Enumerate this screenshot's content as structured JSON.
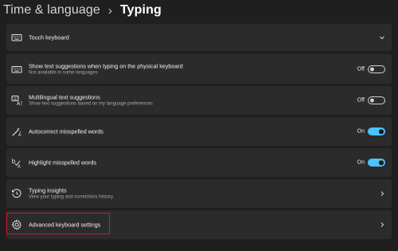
{
  "header": {
    "breadcrumb_parent": "Time & language",
    "separator": "›",
    "page_title": "Typing"
  },
  "settings": {
    "touch_keyboard": {
      "label": "Touch keyboard",
      "icon": "keyboard-icon",
      "expanded": false
    },
    "text_suggestions": {
      "label": "Show text suggestions when typing on the physical keyboard",
      "sublabel": "Not available in some languages",
      "state": "Off",
      "enabled": false,
      "icon": "keyboard-suggestions-icon"
    },
    "multilingual": {
      "label": "Multilingual text suggestions",
      "sublabel": "Show text suggestions based on my language preferences",
      "state": "Off",
      "enabled": false,
      "icon": "multilingual-icon"
    },
    "autocorrect": {
      "label": "Autocorrect misspelled words",
      "state": "On",
      "enabled": true,
      "icon": "autocorrect-icon"
    },
    "highlight": {
      "label": "Highlight misspelled words",
      "state": "On",
      "enabled": true,
      "icon": "spellcheck-icon"
    },
    "typing_insights": {
      "label": "Typing insights",
      "sublabel": "View your typing and corrections history",
      "icon": "history-icon"
    },
    "advanced_keyboard": {
      "label": "Advanced keyboard settings",
      "icon": "gear-icon"
    }
  },
  "colors": {
    "accent": "#4cc2ff",
    "background": "#1f1f1f",
    "panel": "#2b2b2b",
    "highlight_border": "#e0171e"
  }
}
